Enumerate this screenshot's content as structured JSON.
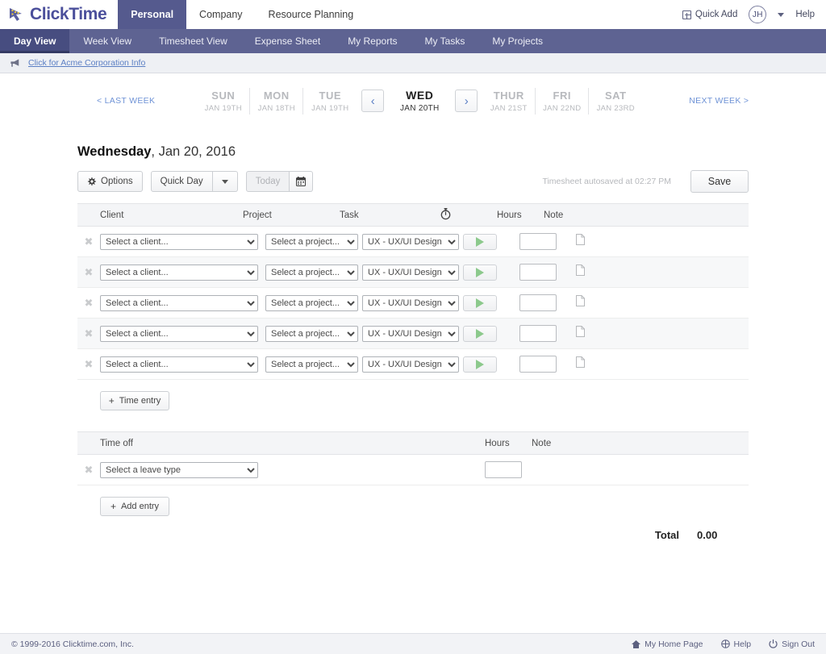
{
  "brand": {
    "name": "ClickTime",
    "logo_icon": "clicktime-cursor-logo",
    "accent_purple": "#5e6392",
    "active_tab_bg": "#555a8e",
    "link_blue": "#5b7fc4"
  },
  "topbar": {
    "tabs": [
      {
        "label": "Personal",
        "active": true
      },
      {
        "label": "Company",
        "active": false
      },
      {
        "label": "Resource Planning",
        "active": false
      }
    ],
    "quick_add": "Quick Add",
    "quick_add_icon": "plus-box-icon",
    "avatar_initials": "JH",
    "help": "Help"
  },
  "subnav": {
    "items": [
      {
        "label": "Day View",
        "active": true
      },
      {
        "label": "Week View",
        "active": false
      },
      {
        "label": "Timesheet View",
        "active": false
      },
      {
        "label": "Expense Sheet",
        "active": false
      },
      {
        "label": "My Reports",
        "active": false
      },
      {
        "label": "My Tasks",
        "active": false
      },
      {
        "label": "My Projects",
        "active": false
      }
    ]
  },
  "notice": {
    "icon": "megaphone-icon",
    "link_text": "Click for Acme Corporation Info"
  },
  "daystrip": {
    "last_week": "< LAST WEEK",
    "next_week": "NEXT WEEK >",
    "prev_arrow": "‹",
    "next_arrow": "›",
    "days_before": [
      {
        "name": "SUN",
        "date": "JAN 19TH"
      },
      {
        "name": "MON",
        "date": "JAN 18TH"
      },
      {
        "name": "TUE",
        "date": "JAN 19TH"
      }
    ],
    "selected": {
      "name": "WED",
      "date": "JAN 20TH"
    },
    "days_after": [
      {
        "name": "THUR",
        "date": "JAN 21ST"
      },
      {
        "name": "FRI",
        "date": "JAN 22ND"
      },
      {
        "name": "SAT",
        "date": "JAN 23RD"
      }
    ]
  },
  "page": {
    "title_bold": "Wednesday",
    "title_rest": ", Jan 20, 2016"
  },
  "toolbar": {
    "options_label": "Options",
    "options_icon": "gear-icon",
    "quick_day_label": "Quick Day",
    "quick_day_caret": "chevron-down-icon",
    "today_label": "Today",
    "calendar_icon": "calendar-icon",
    "autosave_text": "Timesheet autosaved at 02:27 PM",
    "save_label": "Save"
  },
  "time_table": {
    "headers": {
      "client": "Client",
      "project": "Project",
      "task": "Task",
      "timer_icon": "stopwatch-icon",
      "hours": "Hours",
      "note": "Note"
    },
    "rows": [
      {
        "client": "Select a client...",
        "project": "Select a project...",
        "task": "UX - UX/UI Design",
        "hours": "",
        "timer_icon": "play-icon",
        "note_icon": "note-page-icon",
        "delete_icon": "remove-x-icon"
      },
      {
        "client": "Select a client...",
        "project": "Select a project...",
        "task": "UX - UX/UI Design",
        "hours": "",
        "timer_icon": "play-icon",
        "note_icon": "note-page-icon",
        "delete_icon": "remove-x-icon"
      },
      {
        "client": "Select a client...",
        "project": "Select a project...",
        "task": "UX - UX/UI Design",
        "hours": "",
        "timer_icon": "play-icon",
        "note_icon": "note-page-icon",
        "delete_icon": "remove-x-icon"
      },
      {
        "client": "Select a client...",
        "project": "Select a project...",
        "task": "UX - UX/UI Design",
        "hours": "",
        "timer_icon": "play-icon",
        "note_icon": "note-page-icon",
        "delete_icon": "remove-x-icon"
      },
      {
        "client": "Select a client...",
        "project": "Select a project...",
        "task": "UX - UX/UI Design",
        "hours": "",
        "timer_icon": "play-icon",
        "note_icon": "note-page-icon",
        "delete_icon": "remove-x-icon"
      }
    ],
    "add_button": "Time entry",
    "add_icon": "plus-icon"
  },
  "time_off": {
    "headers": {
      "title": "Time off",
      "hours": "Hours",
      "note": "Note"
    },
    "rows": [
      {
        "leave_type": "Select a leave type",
        "hours": "",
        "delete_icon": "remove-x-icon"
      }
    ],
    "add_button": "Add entry",
    "add_icon": "plus-icon"
  },
  "totals": {
    "label": "Total",
    "value": "0.00"
  },
  "footer": {
    "copyright": "© 1999-2016 Clicktime.com, Inc.",
    "links": [
      {
        "label": "My Home Page",
        "icon": "home-icon"
      },
      {
        "label": "Help",
        "icon": "help-globe-icon"
      },
      {
        "label": "Sign Out",
        "icon": "power-icon"
      }
    ]
  }
}
